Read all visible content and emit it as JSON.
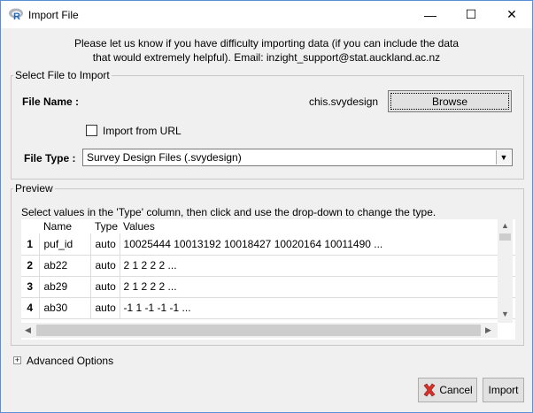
{
  "window": {
    "title": "Import File",
    "minimize": "—",
    "maximize": "☐",
    "close": "✕"
  },
  "info": {
    "line1": "Please let us know if you have difficulty importing data (if you can include the data",
    "line2": "that would extremely helpful). Email: inzight_support@stat.auckland.ac.nz"
  },
  "select_file": {
    "group_label": "Select File to Import",
    "file_name_label": "File Name :",
    "file_name_value": "chis.svydesign",
    "browse_label": "Browse",
    "import_url_label": "Import from URL",
    "import_url_checked": false,
    "file_type_label": "File Type :",
    "file_type_value": "Survey Design Files (.svydesign)"
  },
  "preview": {
    "group_label": "Preview",
    "instructions": "Select values in the 'Type' column, then click and use the drop-down to change the type.",
    "columns": [
      "Name",
      "Type",
      "Values"
    ],
    "rows": [
      {
        "num": "1",
        "name": "puf_id",
        "type": "auto",
        "values": "10025444 10013192 10018427 10020164 10011490 ..."
      },
      {
        "num": "2",
        "name": "ab22",
        "type": "auto",
        "values": "2 1 2 2 2 ..."
      },
      {
        "num": "3",
        "name": "ab29",
        "type": "auto",
        "values": "2 1 2 2 2 ..."
      },
      {
        "num": "4",
        "name": "ab30",
        "type": "auto",
        "values": "-1 1 -1 -1 -1 ..."
      }
    ]
  },
  "advanced": {
    "label": "Advanced Options",
    "expander": "+"
  },
  "footer": {
    "cancel_label": "Cancel",
    "import_label": "Import"
  },
  "colors": {
    "window_border": "#5a8fd6",
    "cancel_icon": "#d9302a"
  }
}
